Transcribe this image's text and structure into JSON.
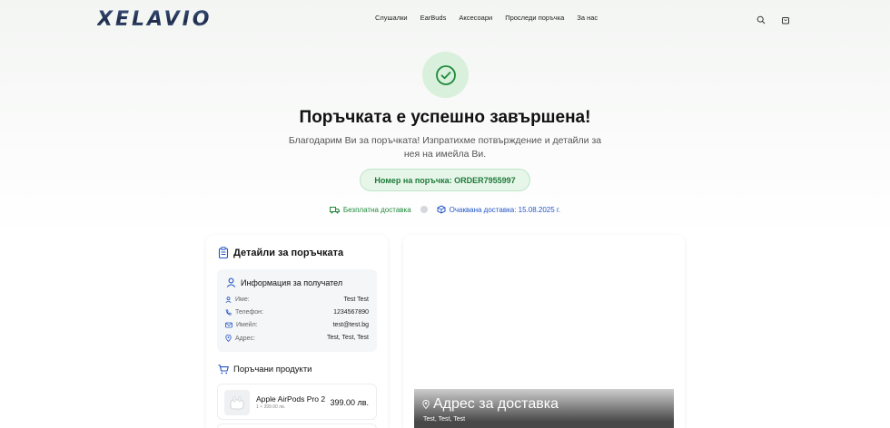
{
  "header": {
    "logo": "XELAVIO",
    "nav": [
      "Слушалки",
      "EarBuds",
      "Аксесоари",
      "Проследи поръчка",
      "За нас"
    ],
    "icons": [
      "search-icon",
      "cart-icon"
    ]
  },
  "success": {
    "title": "Поръчката е успешно завършена!",
    "subtitle": "Благодарим Ви за поръчката! Изпратихме потвърждение и детайли за нея на имейла Ви.",
    "order_number": "Номер на поръчка: ORDER7955997",
    "free_delivery": "Безплатна доставка",
    "expected_delivery": "Очаквана доставка: 15.08.2025 г.",
    "accent": "#1f8a3a"
  },
  "order_details": {
    "title": "Детайли за поръчката",
    "recipient": {
      "title": "Информация за получател",
      "rows": [
        {
          "label": "Име:",
          "value": "Test Test",
          "icon": "user-icon"
        },
        {
          "label": "Телефон:",
          "value": "1234567890",
          "icon": "phone-icon"
        },
        {
          "label": "Имейл:",
          "value": "test@test.bg",
          "icon": "mail-icon"
        },
        {
          "label": "Адрес:",
          "value": "Test, Test, Test",
          "icon": "pin-icon"
        }
      ]
    },
    "products_title": "Поръчани продукти",
    "products": [
      {
        "name": "Apple AirPods Pro 2",
        "qty": "1 × 399.00 лв.",
        "price": "399.00 лв."
      }
    ]
  },
  "delivery_card": {
    "title": "Адрес за доставка",
    "address": "Test, Test, Test"
  }
}
